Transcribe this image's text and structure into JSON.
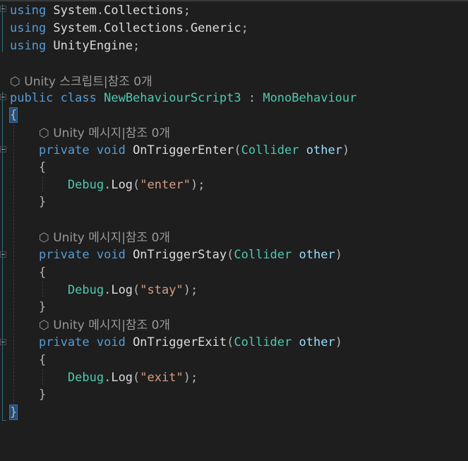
{
  "editor": {
    "lines": [
      {
        "name": "using-collections",
        "segments": [
          [
            "kw",
            "using"
          ],
          [
            "id",
            " System"
          ],
          [
            "punc",
            "."
          ],
          [
            "id",
            "Collections"
          ],
          [
            "punc",
            ";"
          ]
        ]
      },
      {
        "name": "using-generic",
        "segments": [
          [
            "kw",
            "using"
          ],
          [
            "id",
            " System"
          ],
          [
            "punc",
            "."
          ],
          [
            "id",
            "Collections"
          ],
          [
            "punc",
            "."
          ],
          [
            "id",
            "Generic"
          ],
          [
            "punc",
            ";"
          ]
        ]
      },
      {
        "name": "using-unityengine",
        "segments": [
          [
            "kw",
            "using"
          ],
          [
            "id",
            " UnityEngine"
          ],
          [
            "punc",
            ";"
          ]
        ]
      },
      {
        "name": "class-codelens",
        "segments": [
          [
            "lens",
            "⬡ Unity 스크립트|참조 0개"
          ]
        ]
      },
      {
        "name": "class-declaration",
        "segments": [
          [
            "kw",
            "public"
          ],
          [
            "id",
            " "
          ],
          [
            "kw",
            "class"
          ],
          [
            "id",
            " "
          ],
          [
            "type",
            "NewBehaviourScript3"
          ],
          [
            "id",
            " "
          ],
          [
            "punc",
            ":"
          ],
          [
            "id",
            " "
          ],
          [
            "type",
            "MonoBehaviour"
          ]
        ]
      },
      {
        "name": "class-open-brace",
        "segments": [
          [
            "brace",
            "{"
          ]
        ]
      },
      {
        "name": "enter-codelens",
        "segments": [
          [
            "id",
            "    "
          ],
          [
            "lens",
            "⬡ Unity 메시지|참조 0개"
          ]
        ]
      },
      {
        "name": "enter-signature",
        "segments": [
          [
            "id",
            "    "
          ],
          [
            "kw",
            "private"
          ],
          [
            "id",
            " "
          ],
          [
            "kw",
            "void"
          ],
          [
            "id",
            " "
          ],
          [
            "id",
            "OnTriggerEnter"
          ],
          [
            "punc",
            "("
          ],
          [
            "type",
            "Collider"
          ],
          [
            "id",
            " "
          ],
          [
            "param",
            "other"
          ],
          [
            "punc",
            ")"
          ]
        ]
      },
      {
        "name": "enter-open",
        "segments": [
          [
            "id",
            "    "
          ],
          [
            "punc",
            "{"
          ]
        ]
      },
      {
        "name": "enter-body",
        "segments": [
          [
            "id",
            "        "
          ],
          [
            "type",
            "Debug"
          ],
          [
            "punc",
            "."
          ],
          [
            "id",
            "Log"
          ],
          [
            "punc",
            "("
          ],
          [
            "str",
            "\"enter\""
          ],
          [
            "punc",
            ");"
          ]
        ]
      },
      {
        "name": "enter-close",
        "segments": [
          [
            "id",
            "    "
          ],
          [
            "punc",
            "}"
          ]
        ]
      },
      {
        "name": "blank-1",
        "segments": []
      },
      {
        "name": "stay-codelens",
        "segments": [
          [
            "id",
            "    "
          ],
          [
            "lens",
            "⬡ Unity 메시지|참조 0개"
          ]
        ]
      },
      {
        "name": "stay-signature",
        "segments": [
          [
            "id",
            "    "
          ],
          [
            "kw",
            "private"
          ],
          [
            "id",
            " "
          ],
          [
            "kw",
            "void"
          ],
          [
            "id",
            " "
          ],
          [
            "id",
            "OnTriggerStay"
          ],
          [
            "punc",
            "("
          ],
          [
            "type",
            "Collider"
          ],
          [
            "id",
            " "
          ],
          [
            "param",
            "other"
          ],
          [
            "punc",
            ")"
          ]
        ]
      },
      {
        "name": "stay-open",
        "segments": [
          [
            "id",
            "    "
          ],
          [
            "punc",
            "{"
          ]
        ]
      },
      {
        "name": "stay-body",
        "segments": [
          [
            "id",
            "        "
          ],
          [
            "type",
            "Debug"
          ],
          [
            "punc",
            "."
          ],
          [
            "id",
            "Log"
          ],
          [
            "punc",
            "("
          ],
          [
            "str",
            "\"stay\""
          ],
          [
            "punc",
            ");"
          ]
        ]
      },
      {
        "name": "stay-close",
        "segments": [
          [
            "id",
            "    "
          ],
          [
            "punc",
            "}"
          ]
        ]
      },
      {
        "name": "exit-codelens",
        "segments": [
          [
            "id",
            "    "
          ],
          [
            "lens",
            "⬡ Unity 메시지|참조 0개"
          ]
        ]
      },
      {
        "name": "exit-signature",
        "segments": [
          [
            "id",
            "    "
          ],
          [
            "kw",
            "private"
          ],
          [
            "id",
            " "
          ],
          [
            "kw",
            "void"
          ],
          [
            "id",
            " "
          ],
          [
            "id",
            "OnTriggerExit"
          ],
          [
            "punc",
            "("
          ],
          [
            "type",
            "Collider"
          ],
          [
            "id",
            " "
          ],
          [
            "param",
            "other"
          ],
          [
            "punc",
            ")"
          ]
        ]
      },
      {
        "name": "exit-open",
        "segments": [
          [
            "id",
            "    "
          ],
          [
            "punc",
            "{"
          ]
        ]
      },
      {
        "name": "exit-body",
        "segments": [
          [
            "id",
            "        "
          ],
          [
            "type",
            "Debug"
          ],
          [
            "punc",
            "."
          ],
          [
            "id",
            "Log"
          ],
          [
            "punc",
            "("
          ],
          [
            "str",
            "\"exit\""
          ],
          [
            "punc",
            ");"
          ]
        ]
      },
      {
        "name": "exit-close",
        "segments": [
          [
            "id",
            "    "
          ],
          [
            "punc",
            "}"
          ]
        ]
      },
      {
        "name": "class-close-brace",
        "segments": [
          [
            "brace",
            "}"
          ]
        ]
      }
    ]
  },
  "colors": {
    "background": "#1e1e1e",
    "keyword": "#569cd6",
    "type": "#4ec9b0",
    "identifier": "#dcdcdc",
    "parameter": "#9cdcfe",
    "string": "#d69d85",
    "codelens": "#999999",
    "brace_highlight": "#264f78"
  }
}
